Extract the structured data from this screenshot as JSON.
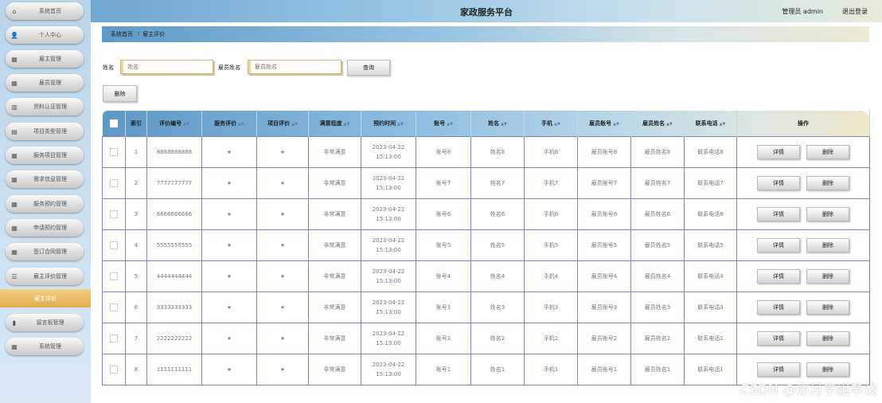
{
  "header": {
    "title": "家政服务平台",
    "user": "管理员 admin",
    "logout": "退出登录"
  },
  "sidebar": {
    "items": [
      {
        "label": "系统首页",
        "icon": "home-icon"
      },
      {
        "label": "个人中心",
        "icon": "user-icon"
      },
      {
        "label": "雇主管理",
        "icon": "grid-icon"
      },
      {
        "label": "雇员管理",
        "icon": "grid-icon"
      },
      {
        "label": "资料认证管理",
        "icon": "chart-icon"
      },
      {
        "label": "项目类型管理",
        "icon": "card-icon"
      },
      {
        "label": "服务项目管理",
        "icon": "grid-icon"
      },
      {
        "label": "需求信息管理",
        "icon": "grid-icon"
      },
      {
        "label": "服务预约管理",
        "icon": "grid-icon"
      },
      {
        "label": "申请预约管理",
        "icon": "grid-icon"
      },
      {
        "label": "签订合同管理",
        "icon": "grid-icon"
      },
      {
        "label": "雇主评价管理",
        "icon": "list-icon"
      },
      {
        "label": "留言板管理",
        "icon": "bar-chart-icon"
      },
      {
        "label": "系统管理",
        "icon": "grid-icon"
      }
    ],
    "sub_item": "雇主评价"
  },
  "breadcrumb": {
    "home": "系统首页",
    "current": "雇主评价"
  },
  "search": {
    "name_label": "姓名",
    "name_placeholder": "姓名",
    "emp_label": "雇员姓名",
    "emp_placeholder": "雇员姓名",
    "query": "查询"
  },
  "toolbar": {
    "delete": "删除"
  },
  "table": {
    "columns": [
      "索引",
      "评价编号",
      "服务评价",
      "项目评价",
      "满意程度",
      "预约时间",
      "账号",
      "姓名",
      "手机",
      "雇员账号",
      "雇员姓名",
      "联系电话",
      "操作"
    ],
    "detail": "详情",
    "delete": "删除",
    "rows": [
      {
        "idx": "1",
        "no": "8888888888",
        "svc": "★",
        "proj": "★",
        "sat": "非常满意",
        "time": "2023-04-22 15:13:00",
        "acc": "账号8",
        "name": "姓名8",
        "phone": "手机8",
        "eacc": "雇员账号8",
        "ename": "雇员姓名8",
        "tel": "联系电话8"
      },
      {
        "idx": "2",
        "no": "7777777777",
        "svc": "★",
        "proj": "★",
        "sat": "非常满意",
        "time": "2023-04-22 15:13:00",
        "acc": "账号7",
        "name": "姓名7",
        "phone": "手机7",
        "eacc": "雇员账号7",
        "ename": "雇员姓名7",
        "tel": "联系电话7"
      },
      {
        "idx": "3",
        "no": "6666666666",
        "svc": "★",
        "proj": "★",
        "sat": "非常满意",
        "time": "2023-04-22 15:13:00",
        "acc": "账号6",
        "name": "姓名6",
        "phone": "手机6",
        "eacc": "雇员账号6",
        "ename": "雇员姓名6",
        "tel": "联系电话6"
      },
      {
        "idx": "4",
        "no": "5555555555",
        "svc": "★",
        "proj": "★",
        "sat": "非常满意",
        "time": "2023-04-22 15:13:00",
        "acc": "账号5",
        "name": "姓名5",
        "phone": "手机5",
        "eacc": "雇员账号5",
        "ename": "雇员姓名5",
        "tel": "联系电话5"
      },
      {
        "idx": "5",
        "no": "4444444444",
        "svc": "★",
        "proj": "★",
        "sat": "非常满意",
        "time": "2023-04-22 15:13:00",
        "acc": "账号4",
        "name": "姓名4",
        "phone": "手机4",
        "eacc": "雇员账号4",
        "ename": "雇员姓名4",
        "tel": "联系电话4"
      },
      {
        "idx": "6",
        "no": "3333333333",
        "svc": "★",
        "proj": "★",
        "sat": "非常满意",
        "time": "2023-04-22 15:13:00",
        "acc": "账号3",
        "name": "姓名3",
        "phone": "手机3",
        "eacc": "雇员账号3",
        "ename": "雇员姓名3",
        "tel": "联系电话3"
      },
      {
        "idx": "7",
        "no": "2222222222",
        "svc": "★",
        "proj": "★",
        "sat": "非常满意",
        "time": "2023-04-22 15:13:00",
        "acc": "账号2",
        "name": "姓名2",
        "phone": "手机2",
        "eacc": "雇员账号2",
        "ename": "雇员姓名2",
        "tel": "联系电话2"
      },
      {
        "idx": "8",
        "no": "1111111111",
        "svc": "★",
        "proj": "★",
        "sat": "非常满意",
        "time": "2023-04-22 15:13:00",
        "acc": "账号1",
        "name": "姓名1",
        "phone": "手机1",
        "eacc": "雇员账号1",
        "ename": "雇员姓名1",
        "tel": "联系电话1"
      }
    ]
  },
  "watermark": "CSDN @亦月学姐毕设"
}
